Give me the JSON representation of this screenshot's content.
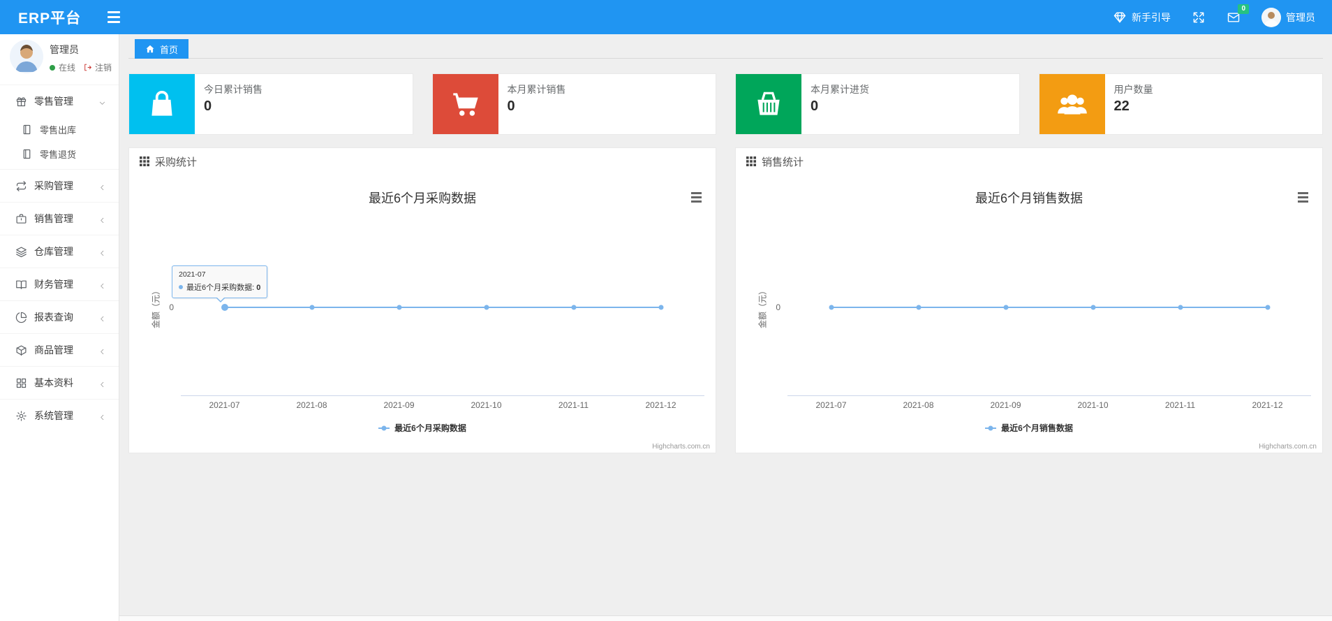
{
  "navbar": {
    "brand": "ERP平台",
    "guide_label": "新手引导",
    "message_badge": "0",
    "user_name": "管理员",
    "accent_color": "#2095f2",
    "badge_color": "#26c281",
    "icons": [
      "hamburger-icon",
      "diamond-icon",
      "fullscreen-icon",
      "envelope-icon",
      "avatar"
    ]
  },
  "sidebar": {
    "user": {
      "name": "管理员",
      "status": "在线",
      "logout_label": "注销"
    },
    "items": [
      {
        "label": "零售管理",
        "icon": "gift-icon",
        "expanded": true,
        "children": [
          {
            "label": "零售出库",
            "icon": "notebook-icon"
          },
          {
            "label": "零售退货",
            "icon": "notebook-icon"
          }
        ]
      },
      {
        "label": "采购管理",
        "icon": "repeat-icon",
        "expanded": false
      },
      {
        "label": "销售管理",
        "icon": "briefcase-icon",
        "expanded": false
      },
      {
        "label": "仓库管理",
        "icon": "layers-icon",
        "expanded": false
      },
      {
        "label": "财务管理",
        "icon": "book-icon",
        "expanded": false
      },
      {
        "label": "报表查询",
        "icon": "pie-chart-icon",
        "expanded": false
      },
      {
        "label": "商品管理",
        "icon": "cube-icon",
        "expanded": false
      },
      {
        "label": "基本资料",
        "icon": "grid-icon",
        "expanded": false
      },
      {
        "label": "系统管理",
        "icon": "gear-icon",
        "expanded": false
      }
    ]
  },
  "tabs": {
    "home_label": "首页"
  },
  "stat_cards": [
    {
      "label": "今日累计销售",
      "value": "0",
      "color": "#00c0ef",
      "icon": "shopping-bag-icon"
    },
    {
      "label": "本月累计销售",
      "value": "0",
      "color": "#dd4b39",
      "icon": "cart-icon"
    },
    {
      "label": "本月累计进货",
      "value": "0",
      "color": "#00a65a",
      "icon": "basket-icon"
    },
    {
      "label": "用户数量",
      "value": "22",
      "color": "#f39c12",
      "icon": "users-icon"
    }
  ],
  "panels": [
    {
      "header": "采购统计",
      "icon": "th-grid-icon"
    },
    {
      "header": "销售统计",
      "icon": "th-grid-icon"
    }
  ],
  "chart_data": [
    {
      "type": "line",
      "title": "最近6个月采购数据",
      "categories": [
        "2021-07",
        "2021-08",
        "2021-09",
        "2021-10",
        "2021-11",
        "2021-12"
      ],
      "series": [
        {
          "name": "最近6个月采购数据",
          "values": [
            0,
            0,
            0,
            0,
            0,
            0
          ],
          "color": "#7cb5ec"
        }
      ],
      "xlabel": "",
      "ylabel": "金额（元）",
      "yticks": [
        "0"
      ],
      "ylim": [
        0,
        0
      ],
      "grid": false,
      "legend_position": "bottom",
      "credit": "Highcharts.com.cn",
      "tooltip": {
        "visible": true,
        "header": "2021-07",
        "series": "最近6个月采购数据",
        "value": "0",
        "point_index": 0
      }
    },
    {
      "type": "line",
      "title": "最近6个月销售数据",
      "categories": [
        "2021-07",
        "2021-08",
        "2021-09",
        "2021-10",
        "2021-11",
        "2021-12"
      ],
      "series": [
        {
          "name": "最近6个月销售数据",
          "values": [
            0,
            0,
            0,
            0,
            0,
            0
          ],
          "color": "#7cb5ec"
        }
      ],
      "xlabel": "",
      "ylabel": "金额（元）",
      "yticks": [
        "0"
      ],
      "ylim": [
        0,
        0
      ],
      "grid": false,
      "legend_position": "bottom",
      "credit": "Highcharts.com.cn",
      "tooltip": {
        "visible": false
      }
    }
  ]
}
